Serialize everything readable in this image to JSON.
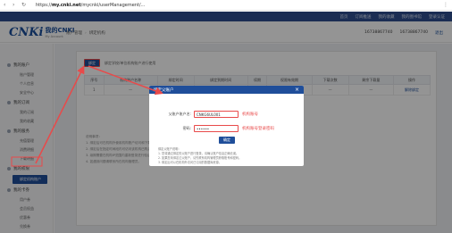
{
  "browser": {
    "url_prefix": "https://",
    "url_domain": "my.cnki.net",
    "url_path": "/mycnki/userManagement/..."
  },
  "topstrip": {
    "links": [
      "首页",
      "订阅推送",
      "我的收藏",
      "我的图书馆",
      "登录认证"
    ]
  },
  "header": {
    "logo_mark": "CNKi",
    "logo_cn": "我的CNKI",
    "logo_en": "My Account",
    "breadcrumb": [
      "账户管理",
      "绑定机构"
    ],
    "user": "16738867740",
    "phone": "16738867740",
    "logout": "退出"
  },
  "sidebar": {
    "groups": [
      {
        "label": "我的账户",
        "items": [
          "账户管理",
          "个人信息",
          "安全中心"
        ]
      },
      {
        "label": "我的订阅",
        "items": [
          "我的订阅",
          "我的收藏"
        ]
      },
      {
        "label": "我的服务",
        "items": [
          "充值管理",
          "消费明细",
          "下载明细"
        ]
      },
      {
        "label": "我的权限",
        "items": [
          "绑定机构账户"
        ]
      },
      {
        "label": "我的卡券",
        "items": [
          "用户券",
          "会员权益",
          "优惠券",
          "兑换券"
        ]
      }
    ],
    "active_item": "绑定机构账户"
  },
  "main": {
    "bind_button": "绑定",
    "bind_hint": "绑定学校/单位机构账户进行使用",
    "table_headers": [
      "序号",
      "机构账户名称",
      "绑定时间",
      "绑定到期时间",
      "续期",
      "权限有效期",
      "下载次数",
      "剩余下载量",
      "操作"
    ],
    "table_row": [
      "1",
      "—",
      "—",
      "—",
      "—",
      "—",
      "—",
      "—",
      "解除绑定"
    ],
    "notes": [
      "说明事项：",
      "1. 绑定后可在机构外使用机构账户访问和下载文献。",
      "2. 绑定后在指定时间段内可访问该机构已购买的资源。",
      "3. 续期需要在机构IP范围内重新登录进行验证。",
      "4. 如遇到问题请联系所在机构管理员。"
    ]
  },
  "modal": {
    "title": "绑定父账户",
    "close_glyph": "×",
    "fields": [
      {
        "label": "父账户账户名:",
        "value": "CNKG6UL001",
        "note": "机构账号"
      },
      {
        "label": "密码:",
        "value": "••••••",
        "note": "机构账号登录密码"
      }
    ],
    "confirm": "确定",
    "notes": [
      "绑定父账户说明：",
      "1. 您将通过绑定的父账户进行登录，请确认账户信息正确无误。",
      "2. 如果您未绑定过父账户，请先联系机构管理员获取账号和密码。",
      "3. 绑定后可以在机构外访问已订阅的数据库资源。"
    ]
  },
  "colors": {
    "brand_blue": "#1f4e9a",
    "annotation_red": "#e84a4a",
    "overlay": "rgba(0,0,0,0.42)"
  }
}
